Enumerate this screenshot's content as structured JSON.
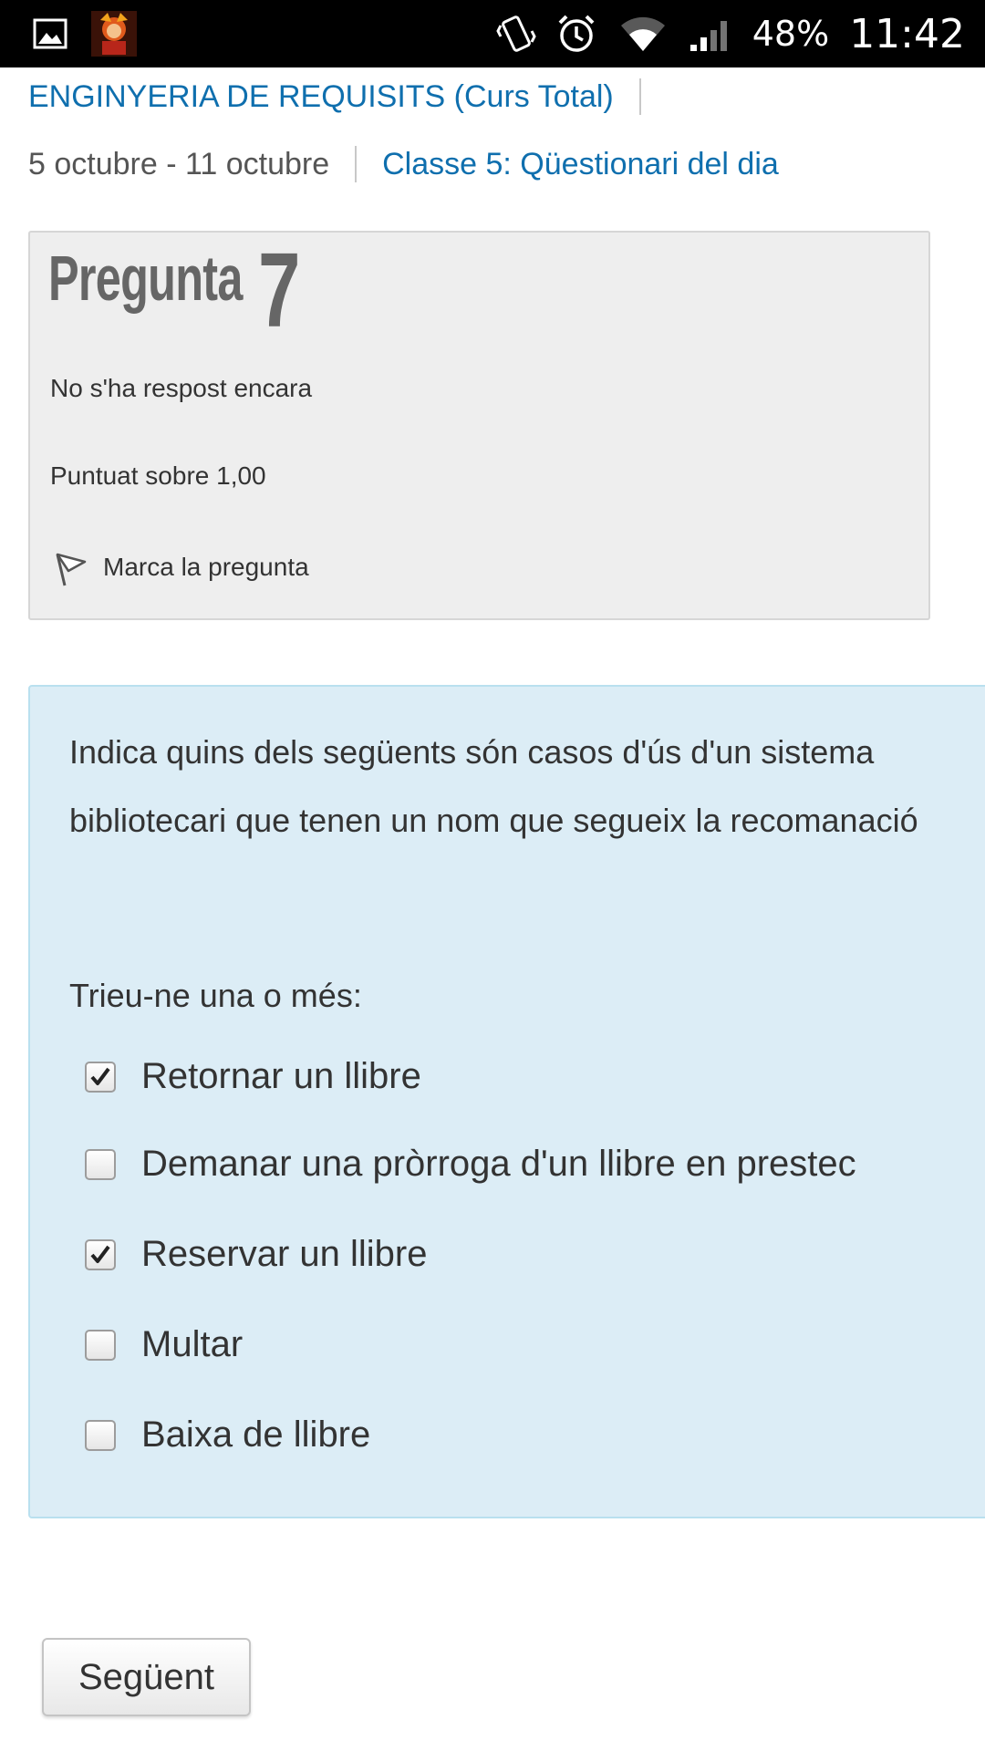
{
  "status_bar": {
    "battery": "48%",
    "time": "11:42",
    "icons": [
      "image-icon",
      "app-avatar-icon",
      "vibrate-icon",
      "alarm-icon",
      "wifi-icon",
      "signal-icon"
    ]
  },
  "breadcrumb": {
    "course": "ENGINYERIA DE REQUISITS (Curs Total)",
    "week": "5 octubre - 11 octubre",
    "quiz": "Classe 5: Qüestionari del dia"
  },
  "question_info": {
    "heading_word": "Pregunta",
    "number": "7",
    "state": "No s'ha respost encara",
    "grade": "Puntuat sobre 1,00",
    "flag_label": "Marca la pregunta"
  },
  "question": {
    "text": "Indica quins dels següents són casos d'ús d'un sistema bibliotecari que tenen un nom que segueix la recomanació",
    "prompt": "Trieu-ne una o més:",
    "options": [
      {
        "label": "Retornar un llibre",
        "checked": true
      },
      {
        "label": "Demanar una pròrroga d'un llibre en prestec",
        "checked": false
      },
      {
        "label": "Reservar un llibre",
        "checked": true
      },
      {
        "label": "Multar",
        "checked": false
      },
      {
        "label": "Baixa de llibre",
        "checked": false
      }
    ]
  },
  "navigation": {
    "next_label": "Següent"
  },
  "colors": {
    "link": "#0f6fae",
    "info_bg": "#eeeeee",
    "content_bg": "#dcedf6",
    "content_border": "#b9e0ef"
  }
}
